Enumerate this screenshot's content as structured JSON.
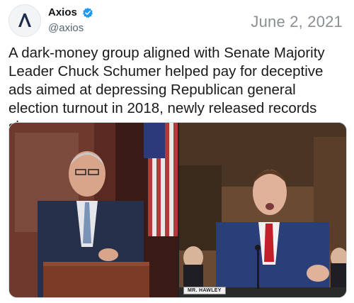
{
  "account": {
    "display_name": "Axios",
    "handle": "@axios",
    "avatar_icon": "axios-logo-icon",
    "verified_icon": "verified-badge-icon",
    "verified_color": "#1d9bf0"
  },
  "tweet": {
    "date": "June 2, 2021",
    "text": "A dark-money group aligned with Senate Majority Leader Chuck Schumer helped pay for deceptive ads aimed at depressing Republican general election turnout in 2018, newly released records show."
  },
  "media": {
    "nameplate_text": "MR. HAWLEY"
  }
}
